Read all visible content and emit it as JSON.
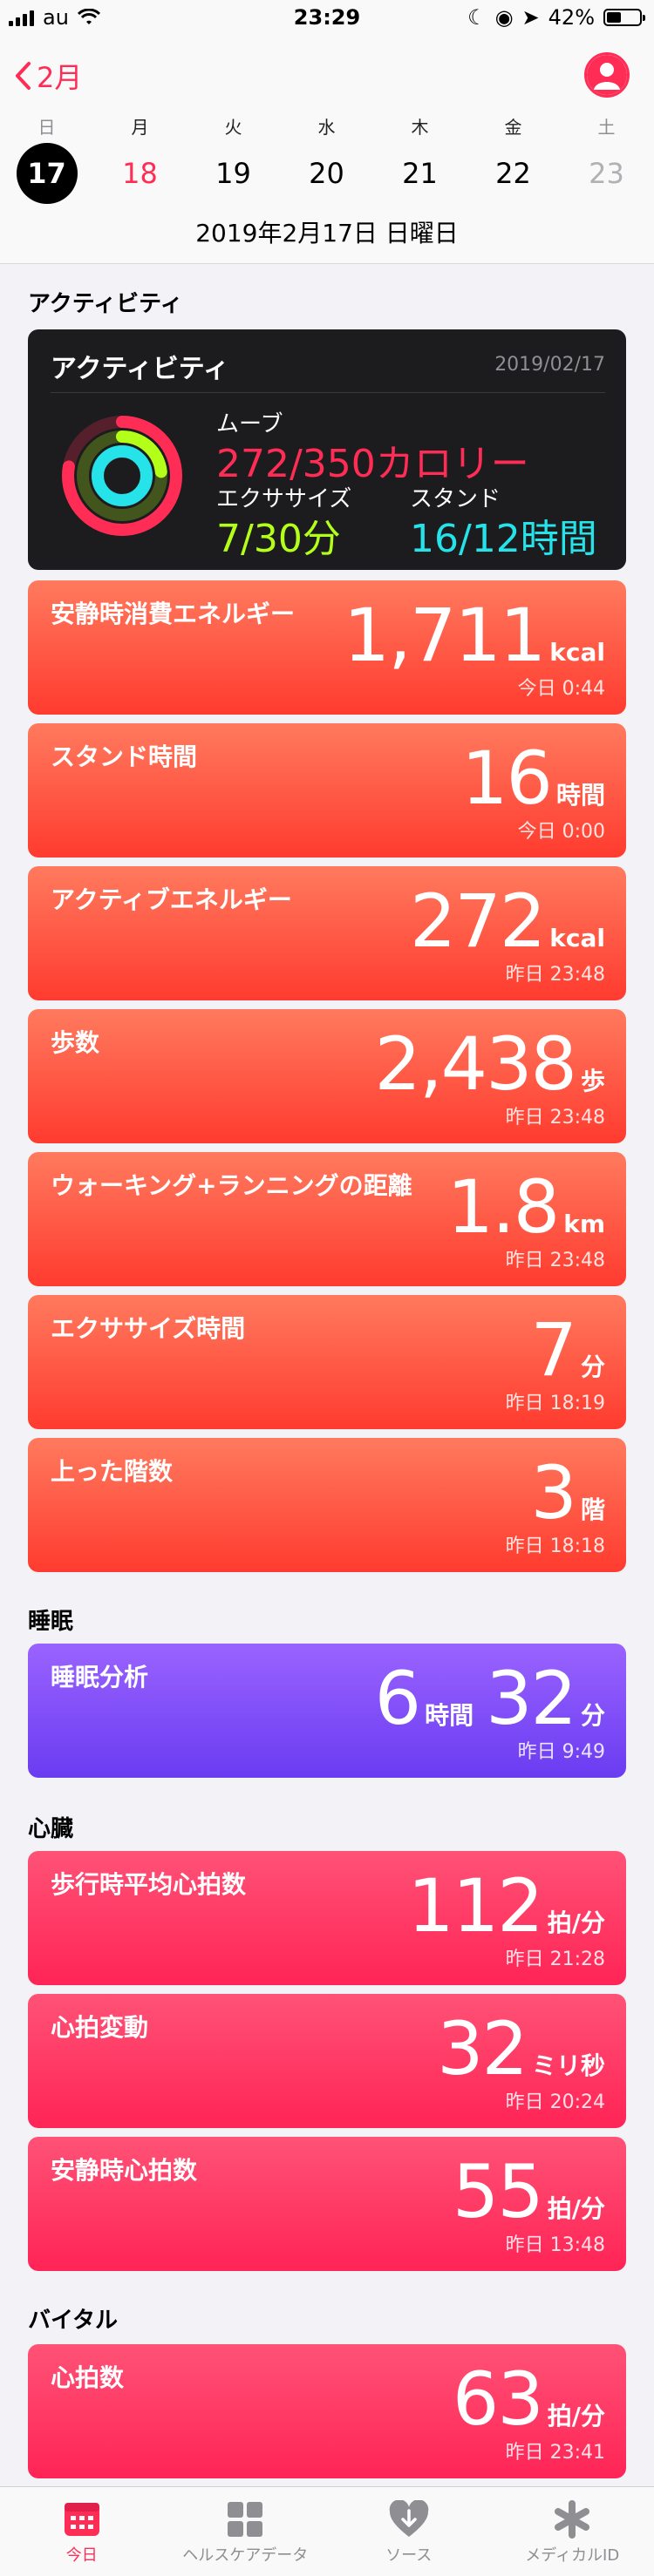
{
  "status": {
    "carrier": "au",
    "time": "23:29",
    "battery": "42%"
  },
  "nav": {
    "back_label": "2月"
  },
  "calendar": {
    "weekdays": [
      "日",
      "月",
      "火",
      "水",
      "木",
      "金",
      "土"
    ],
    "dates": [
      "17",
      "18",
      "19",
      "20",
      "21",
      "22",
      "23"
    ],
    "full_date": "2019年2月17日 日曜日"
  },
  "activity": {
    "section": "アクティビティ",
    "title": "アクティビティ",
    "date": "2019/02/17",
    "move_label": "ムーブ",
    "move_value": "272/350カロリー",
    "exercise_label": "エクササイズ",
    "exercise_value": "7/30分",
    "stand_label": "スタンド",
    "stand_value": "16/12時間",
    "colors": {
      "move": "#ff2d55",
      "exercise": "#b4ff1a",
      "stand": "#25e3e8"
    },
    "rings": {
      "move": 0.777,
      "exercise": 0.233,
      "stand": 1.0
    },
    "cards": [
      {
        "label": "安静時消費エネルギー",
        "value": "1,711",
        "unit": "kcal",
        "time": "今日 0:44"
      },
      {
        "label": "スタンド時間",
        "value": "16",
        "unit": "時間",
        "time": "今日 0:00"
      },
      {
        "label": "アクティブエネルギー",
        "value": "272",
        "unit": "kcal",
        "time": "昨日 23:48"
      },
      {
        "label": "歩数",
        "value": "2,438",
        "unit": "歩",
        "time": "昨日 23:48"
      },
      {
        "label": "ウォーキング+ランニングの距離",
        "value": "1.8",
        "unit": "km",
        "time": "昨日 23:48"
      },
      {
        "label": "エクササイズ時間",
        "value": "7",
        "unit": "分",
        "time": "昨日 18:19"
      },
      {
        "label": "上った階数",
        "value": "3",
        "unit": "階",
        "time": "昨日 18:18"
      }
    ]
  },
  "sleep": {
    "section": "睡眠",
    "label": "睡眠分析",
    "hours": "6",
    "hours_unit": "時間",
    "minutes": "32",
    "minutes_unit": "分",
    "time": "昨日 9:49"
  },
  "heart": {
    "section": "心臓",
    "cards": [
      {
        "label": "歩行時平均心拍数",
        "value": "112",
        "unit": "拍/分",
        "time": "昨日 21:28"
      },
      {
        "label": "心拍変動",
        "value": "32",
        "unit": "ミリ秒",
        "time": "昨日 20:24"
      },
      {
        "label": "安静時心拍数",
        "value": "55",
        "unit": "拍/分",
        "time": "昨日 13:48"
      }
    ]
  },
  "vitals": {
    "section": "バイタル",
    "cards": [
      {
        "label": "心拍数",
        "value": "63",
        "unit": "拍/分",
        "time": "昨日 23:41"
      }
    ]
  },
  "tabs": [
    {
      "label": "今日",
      "icon": "today-icon"
    },
    {
      "label": "ヘルスケアデータ",
      "icon": "grid-icon"
    },
    {
      "label": "ソース",
      "icon": "heart-download-icon"
    },
    {
      "label": "メディカルID",
      "icon": "asterisk-icon"
    }
  ]
}
